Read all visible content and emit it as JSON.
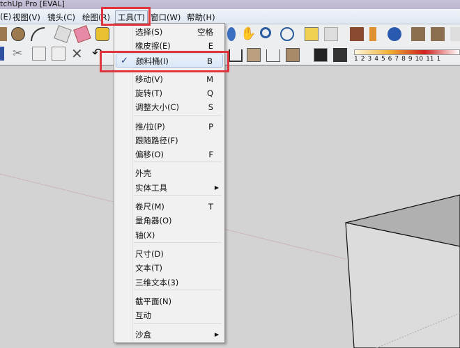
{
  "window": {
    "title": "tchUp Pro [EVAL]"
  },
  "menubar": [
    {
      "label": "(E)"
    },
    {
      "label": "视图(V)"
    },
    {
      "label": "镜头(C)"
    },
    {
      "label": "绘图(R)"
    },
    {
      "label": "工具(T)"
    },
    {
      "label": "窗口(W)"
    },
    {
      "label": "帮助(H)"
    }
  ],
  "scale_numbers": [
    "1",
    "2",
    "3",
    "4",
    "5",
    "6",
    "7",
    "8",
    "9",
    "10",
    "11",
    "1"
  ],
  "tools_menu": {
    "items": [
      {
        "label": "选择(S)",
        "key": "空格"
      },
      {
        "label": "橡皮擦(E)",
        "key": "E"
      },
      {
        "label": "颜料桶(I)",
        "key": "B",
        "checked": true
      },
      {
        "label": "移动(V)",
        "key": "M"
      },
      {
        "label": "旋转(T)",
        "key": "Q"
      },
      {
        "label": "调整大小(C)",
        "key": "S"
      },
      {
        "label": "推/拉(P)",
        "key": "P"
      },
      {
        "label": "跟随路径(F)",
        "key": ""
      },
      {
        "label": "偏移(O)",
        "key": "F"
      },
      {
        "label": "外壳",
        "key": ""
      },
      {
        "label": "实体工具",
        "key": "",
        "submenu": true
      },
      {
        "label": "卷尺(M)",
        "key": "T"
      },
      {
        "label": "量角器(O)",
        "key": ""
      },
      {
        "label": "轴(X)",
        "key": ""
      },
      {
        "label": "尺寸(D)",
        "key": ""
      },
      {
        "label": "文本(T)",
        "key": ""
      },
      {
        "label": "三维文本(3)",
        "key": ""
      },
      {
        "label": "截平面(N)",
        "key": ""
      },
      {
        "label": "互动",
        "key": ""
      },
      {
        "label": "沙盒",
        "key": "",
        "submenu": true
      }
    ]
  },
  "colors": {
    "highlight": "#e0353c",
    "canvas": "#d3d3d3",
    "check": "#1b3c88"
  }
}
